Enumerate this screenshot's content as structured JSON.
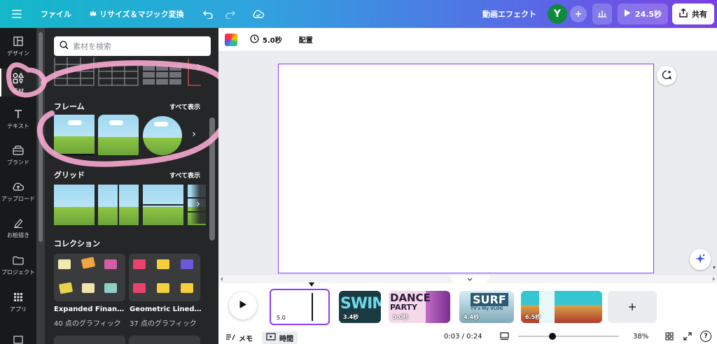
{
  "topbar": {
    "file": "ファイル",
    "resize": "リサイズ＆マジック変換",
    "video_effect": "動画エフェクト",
    "avatar": "Y",
    "play_duration": "24.5秒",
    "share": "共有"
  },
  "rail": {
    "items": [
      {
        "label": "デザイン",
        "icon": "layout-icon"
      },
      {
        "label": "素材",
        "icon": "elements-icon"
      },
      {
        "label": "テキスト",
        "icon": "text-icon"
      },
      {
        "label": "ブランド",
        "icon": "brand-icon"
      },
      {
        "label": "アップロード",
        "icon": "upload-icon"
      },
      {
        "label": "お絵描き",
        "icon": "draw-icon"
      },
      {
        "label": "プロジェクト",
        "icon": "folder-icon"
      },
      {
        "label": "アプリ",
        "icon": "apps-icon"
      }
    ]
  },
  "panel": {
    "search_placeholder": "素材を検索",
    "frames_title": "フレーム",
    "frames_link": "すべて表示",
    "grids_title": "グリッド",
    "grids_link": "すべて表示",
    "collections_title": "コレクション",
    "collections": [
      {
        "title": "Expanded Finance ...",
        "sub": "40 点のグラフィック"
      },
      {
        "title": "Geometric Lined Ki...",
        "sub": "37 点のグラフィック"
      }
    ]
  },
  "canvas_toolbar": {
    "duration": "5.0秒",
    "layout": "配置"
  },
  "timeline": {
    "clips": [
      {
        "duration": "5.0"
      },
      {
        "duration": "3.4秒",
        "text": "SWIM"
      },
      {
        "duration": "5.0秒",
        "text": "DANCE",
        "text2": "PARTY"
      },
      {
        "duration": "4.4秒",
        "text": "SURF",
        "text2": "TV's My VLOG"
      },
      {
        "duration": "6.5秒"
      }
    ],
    "notes": "メモ",
    "time_btn": "時間",
    "time_readout": "0:03 / 0:24",
    "zoom": "38%",
    "help": "?"
  },
  "colors": {
    "accent": "#8b3dff",
    "rail_bg": "#18191b",
    "panel_bg": "#252627",
    "avatar_bg": "#0e8a3c",
    "doodle": "#f7a8cf"
  }
}
